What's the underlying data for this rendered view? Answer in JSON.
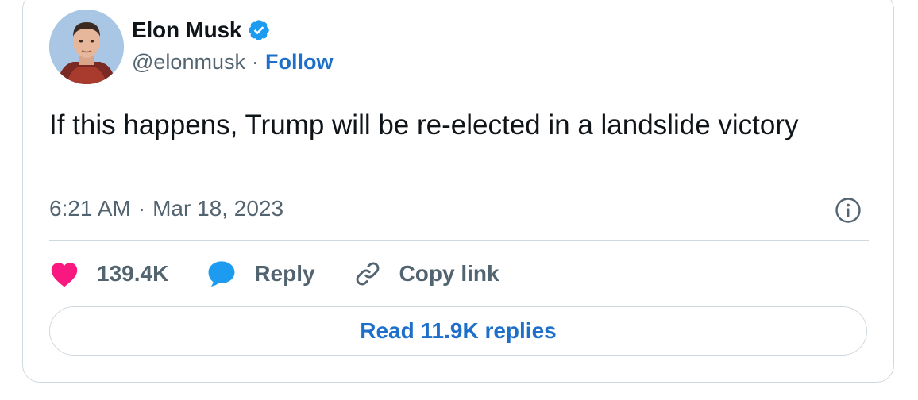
{
  "author": {
    "name": "Elon Musk",
    "handle": "@elonmusk",
    "separator": "·",
    "follow_label": "Follow",
    "verified": true
  },
  "tweet": {
    "text": "If this happens, Trump will be re-elected in a landslide victory",
    "time": "6:21 AM",
    "separator": "·",
    "date": "Mar 18, 2023"
  },
  "actions": {
    "likes_count": "139.4K",
    "reply_label": "Reply",
    "copy_link_label": "Copy link"
  },
  "read_replies_label": "Read 11.9K replies",
  "icons": {
    "like": "heart-icon",
    "reply": "speech-bubble-icon",
    "copy": "link-icon",
    "info": "info-icon",
    "verified": "verified-badge-icon"
  },
  "colors": {
    "like": "#f91880",
    "reply": "#1d9bf0",
    "link_text": "#1d6fc9",
    "secondary_text": "#536471",
    "border": "#cfd9de",
    "verified": "#1d9bf0"
  }
}
